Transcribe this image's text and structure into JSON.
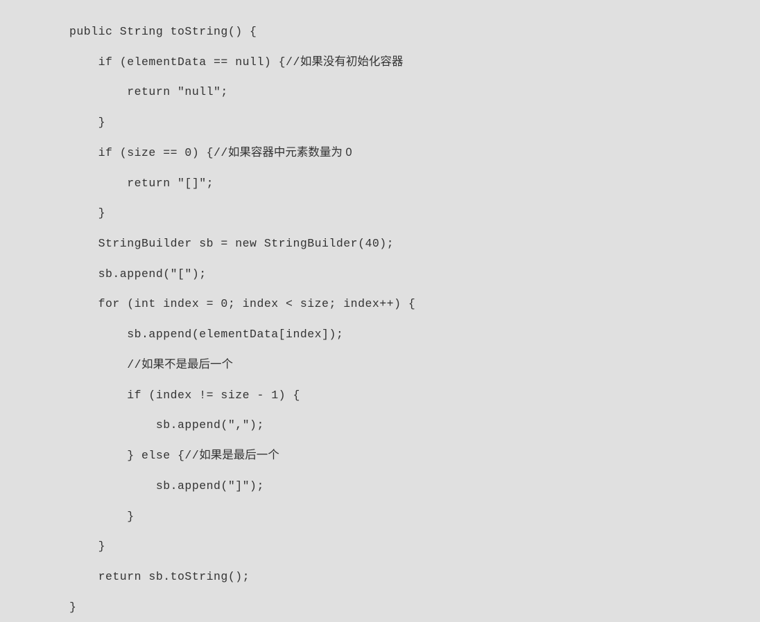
{
  "code": {
    "lines": [
      {
        "indent": 0,
        "text": "public String toString() {"
      },
      {
        "indent": 1,
        "text": "if (elementData == null) {//",
        "cjk": "如果没有初始化容器"
      },
      {
        "indent": 2,
        "text": "return \"null\";"
      },
      {
        "indent": 1,
        "text": "}"
      },
      {
        "indent": 1,
        "text": "if (size == 0) {//",
        "cjk": "如果容器中元素数量为 0"
      },
      {
        "indent": 2,
        "text": "return \"[]\";"
      },
      {
        "indent": 1,
        "text": "}"
      },
      {
        "indent": 1,
        "text": "StringBuilder sb = new StringBuilder(40);"
      },
      {
        "indent": 1,
        "text": "sb.append(\"[\");"
      },
      {
        "indent": 1,
        "text": "for (int index = 0; index < size; index++) {"
      },
      {
        "indent": 2,
        "text": "sb.append(elementData[index]);"
      },
      {
        "indent": 2,
        "text": "//",
        "cjk": "如果不是最后一个"
      },
      {
        "indent": 2,
        "text": "if (index != size - 1) {"
      },
      {
        "indent": 3,
        "text": "sb.append(\",\");"
      },
      {
        "indent": 2,
        "text": "} else {//",
        "cjk": "如果是最后一个"
      },
      {
        "indent": 3,
        "text": "sb.append(\"]\");"
      },
      {
        "indent": 2,
        "text": "}"
      },
      {
        "indent": 1,
        "text": "}"
      },
      {
        "indent": 1,
        "text": "return sb.toString();"
      },
      {
        "indent": 0,
        "text": "}"
      }
    ]
  }
}
